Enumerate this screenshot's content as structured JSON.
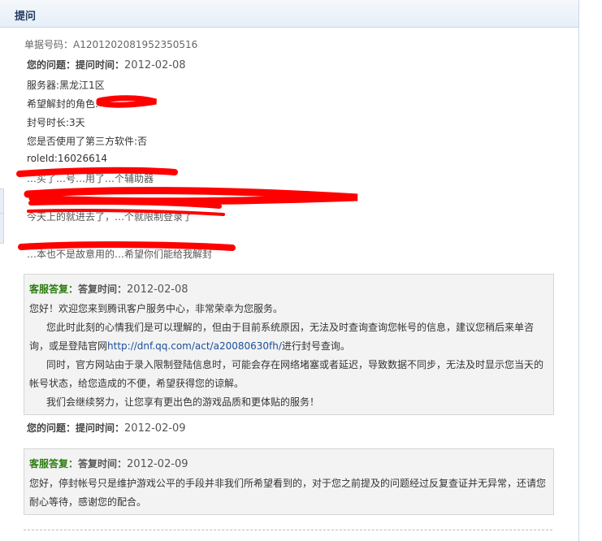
{
  "header": {
    "title": "提问"
  },
  "ticket": {
    "label": "单据号码：A1201202081952350516"
  },
  "question1": {
    "head_label": "您的问题：",
    "time_label": "提问时间：",
    "date": "2012-02-08",
    "fields": [
      "服务器:黑龙江1区",
      "希望解封的角色:",
      "封号时长:3天",
      "您是否使用了第三方软件:否",
      "roleId:16026614"
    ],
    "partial_lines": [
      "…买了…号…用了…个辅助器",
      "今天上的就进去了，…个就限制登录了",
      "…本也不是故意用的…希望你们能给我解封"
    ]
  },
  "reply1": {
    "head_label": "客服答复：",
    "time_label": "答复时间：",
    "date": "2012-02-08",
    "lines": [
      "您好！欢迎您来到腾讯客户服务中心，非常荣幸为您服务。",
      "您此时此刻的心情我们是可以理解的，但由于目前系统原因，无法及时查询查询您帐号的信息，建议您稍后来单咨",
      "询，或是登陆官网",
      "http://dnf.qq.com/act/a20080630fh/",
      "进行封号查询。",
      "同时，官方网站由于录入限制登陆信息时，可能会存在网络堵塞或者延迟，导致数据不同步，无法及时显示您当天的",
      "帐号状态，给您造成的不便，希望获得您的谅解。",
      "我们会继续努力，让您享有更出色的游戏品质和更体贴的服务！"
    ]
  },
  "question2": {
    "head_label": "您的问题：",
    "time_label": "提问时间：",
    "date": "2012-02-09"
  },
  "reply2": {
    "head_label": "客服答复：",
    "time_label": "答复时间：",
    "date": "2012-02-09",
    "lines": [
      "您好，停封帐号只是维护游戏公平的手段并非我们所希望看到的，对于您之前提及的问题经过反复查证并无异常，还请您",
      "耐心等待，感谢您的配合。"
    ]
  },
  "colors": {
    "accent_green": "#2d7d12",
    "link_blue": "#1a4f9c",
    "redaction_red": "#ff0000"
  }
}
